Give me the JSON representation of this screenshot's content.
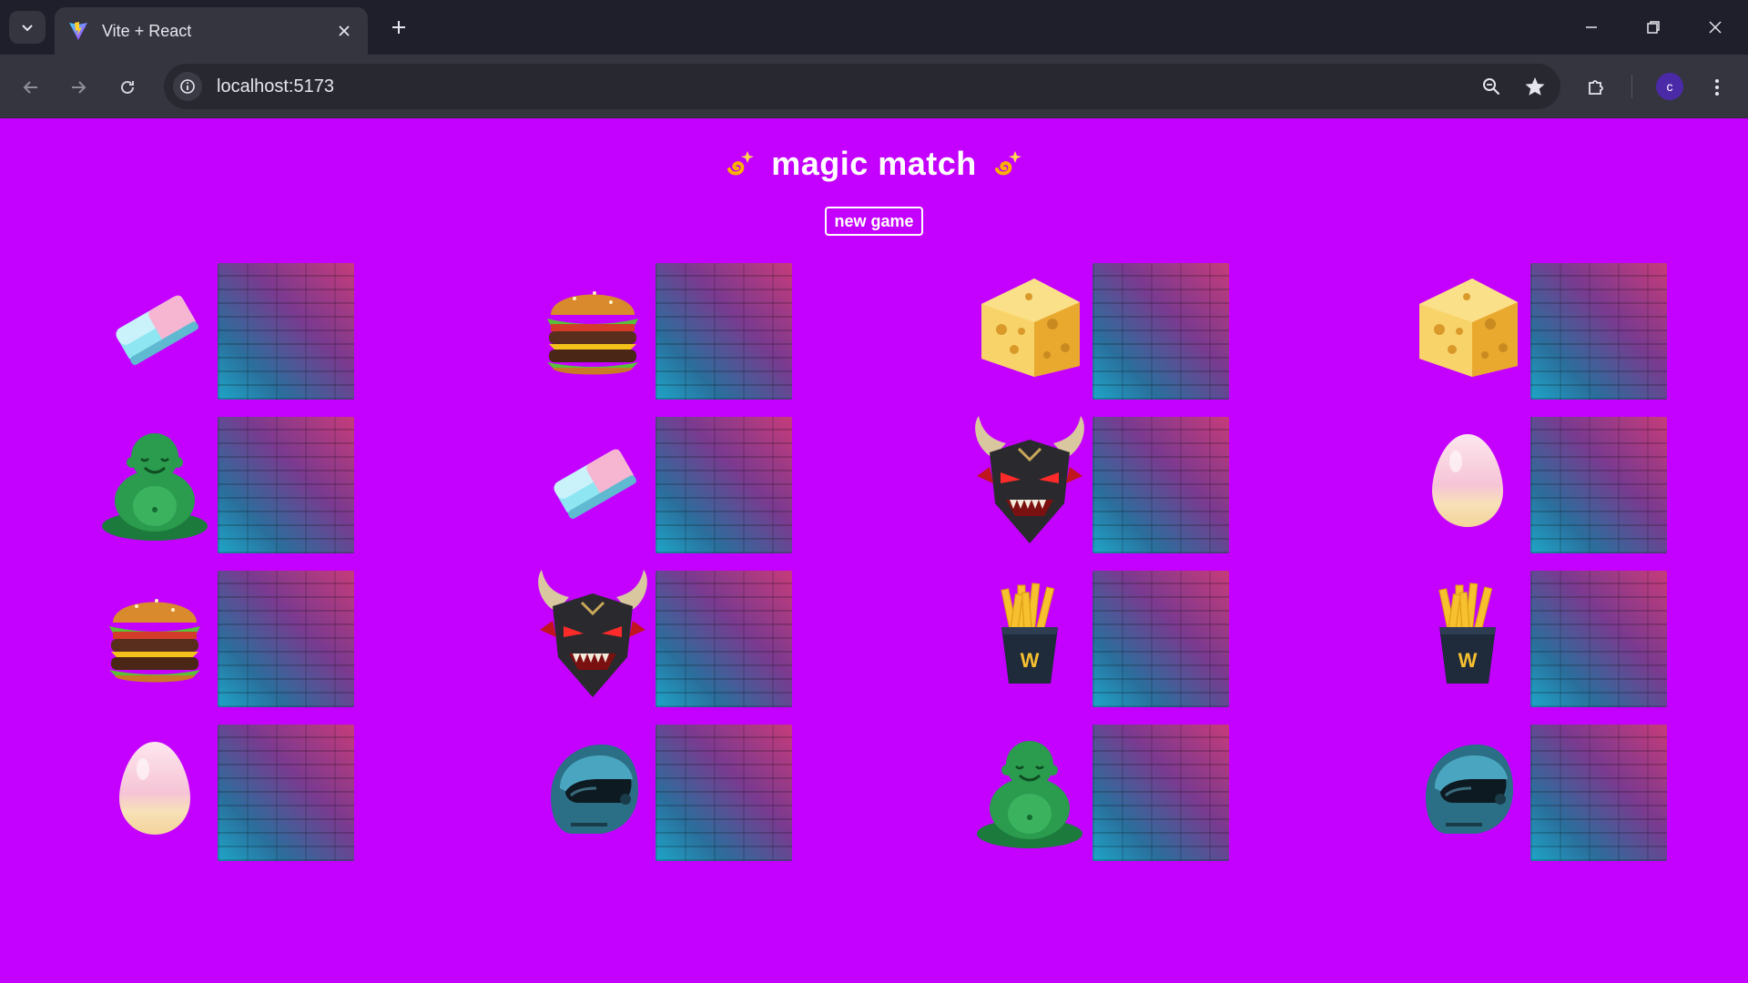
{
  "browser": {
    "tab_title": "Vite + React",
    "url": "localhost:5173",
    "profile_initial": "c"
  },
  "app": {
    "title": "magic match",
    "new_game_label": "new game"
  },
  "cards": [
    {
      "face": "eraser",
      "row": 0,
      "col": 0
    },
    {
      "face": "burger",
      "row": 0,
      "col": 1
    },
    {
      "face": "cheese",
      "row": 0,
      "col": 2
    },
    {
      "face": "cheese",
      "row": 0,
      "col": 3
    },
    {
      "face": "buddha",
      "row": 1,
      "col": 0
    },
    {
      "face": "eraser",
      "row": 1,
      "col": 1
    },
    {
      "face": "demon-mask",
      "row": 1,
      "col": 2
    },
    {
      "face": "egg",
      "row": 1,
      "col": 3
    },
    {
      "face": "burger",
      "row": 2,
      "col": 0
    },
    {
      "face": "demon-mask",
      "row": 2,
      "col": 1
    },
    {
      "face": "fries",
      "row": 2,
      "col": 2
    },
    {
      "face": "fries",
      "row": 2,
      "col": 3
    },
    {
      "face": "egg",
      "row": 3,
      "col": 0
    },
    {
      "face": "helmet",
      "row": 3,
      "col": 1
    },
    {
      "face": "buddha",
      "row": 3,
      "col": 2
    },
    {
      "face": "helmet",
      "row": 3,
      "col": 3
    }
  ],
  "colors": {
    "page_bg": "#c400ff",
    "chrome_dark": "#1f1f2b",
    "chrome_mid": "#35353f"
  }
}
